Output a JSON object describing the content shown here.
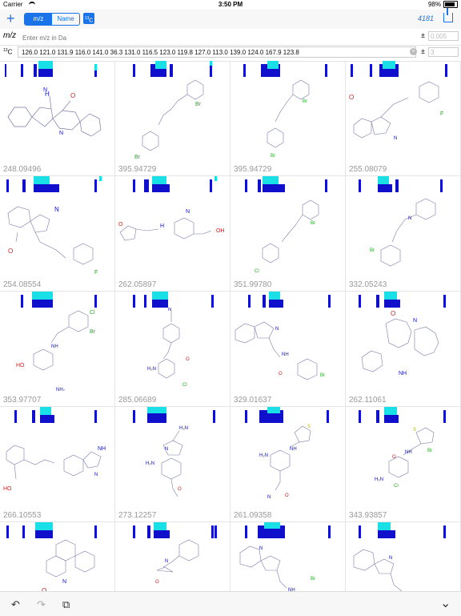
{
  "status": {
    "carrier": "Carrier",
    "time": "3:50 PM",
    "battery": "98%"
  },
  "nav": {
    "seg_mz": "m/z",
    "seg_name": "Name",
    "c13_label": "13C",
    "count": "4181",
    "plus_icon": "+"
  },
  "mz_row": {
    "label": "m/z",
    "placeholder": "Enter m/z in Da",
    "pm": "±",
    "tolerance": "0.005"
  },
  "c13_row": {
    "label": "13C",
    "shifts": "126.0 121.0 131.9 116.0 141.0 36.3 131.0 116.5 123.0 119.8 127.0 113.0 139.0 124.0 167.9 123.8",
    "pm": "±",
    "tolerance": "3"
  },
  "colors": {
    "accent": "#1a73e8",
    "bar_dark": "#1010cc",
    "bar_light": "#19e0e6"
  },
  "cells": [
    {
      "mass": "248.09496"
    },
    {
      "mass": "395.94729"
    },
    {
      "mass": "395.94729"
    },
    {
      "mass": "255.08079"
    },
    {
      "mass": "254.08554"
    },
    {
      "mass": "262.05897"
    },
    {
      "mass": "351.99780"
    },
    {
      "mass": "332.05243"
    },
    {
      "mass": "353.97707"
    },
    {
      "mass": "285.06689"
    },
    {
      "mass": "329.01637"
    },
    {
      "mass": "262.11061"
    },
    {
      "mass": "266.10553"
    },
    {
      "mass": "273.12257"
    },
    {
      "mass": "261.09358"
    },
    {
      "mass": "343.93857"
    },
    {
      "mass": ""
    },
    {
      "mass": ""
    },
    {
      "mass": ""
    },
    {
      "mass": ""
    }
  ],
  "toolbar": {
    "undo": "↶",
    "redo": "↷",
    "copy": "⧉",
    "collapse": "⌄"
  }
}
